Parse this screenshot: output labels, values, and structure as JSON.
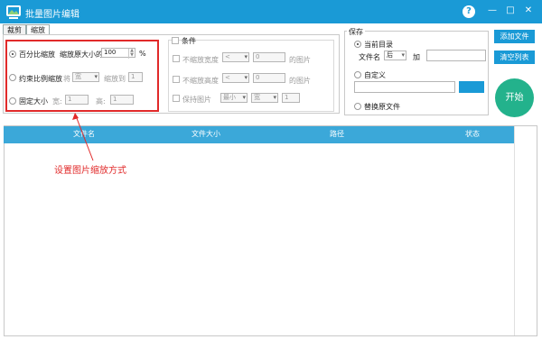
{
  "window": {
    "title": "批量图片编辑",
    "help_label": "?",
    "min_label": "—",
    "max_label": "□",
    "close_label": "✕"
  },
  "tabs": [
    {
      "label": "裁剪",
      "active": false
    },
    {
      "label": "缩放",
      "active": true
    }
  ],
  "scale": {
    "percent_option": "百分比缩放",
    "percent_label": "缩放原大小的",
    "percent_value": "100",
    "percent_unit": "%",
    "ratio_option": "约束比例缩放",
    "ratio_will": "将",
    "ratio_dim": "宽",
    "ratio_to": "缩放到",
    "ratio_value": "1",
    "fixed_option": "固定大小",
    "fixed_width_label": "宽:",
    "fixed_width_value": "1",
    "fixed_height_label": "高:",
    "fixed_height_value": "1"
  },
  "conditions": {
    "header": "条件",
    "no_width_label": "不缩放宽度",
    "no_width_op": "<",
    "no_width_value": "0",
    "no_width_suffix": "的图片",
    "no_height_label": "不缩放高度",
    "no_height_op": "<",
    "no_height_value": "0",
    "no_height_suffix": "的图片",
    "keep_label": "保持图片",
    "keep_mode": "最小",
    "keep_dim": "宽",
    "keep_value": "1"
  },
  "save": {
    "header": "保存",
    "current_dir": "当前目录",
    "filename_label": "文件名",
    "filename_pos": "后",
    "add_label": "加",
    "custom": "自定义",
    "replace": "替换原文件"
  },
  "buttons": {
    "add_file": "添加文件",
    "clear_list": "清空列表",
    "start": "开始"
  },
  "table": {
    "columns": [
      "文件名",
      "文件大小",
      "路径",
      "状态"
    ]
  },
  "annotation": "设置图片缩放方式",
  "colors": {
    "accent": "#1a9ad6",
    "start": "#23b28c",
    "annotation": "#e12a2a"
  }
}
